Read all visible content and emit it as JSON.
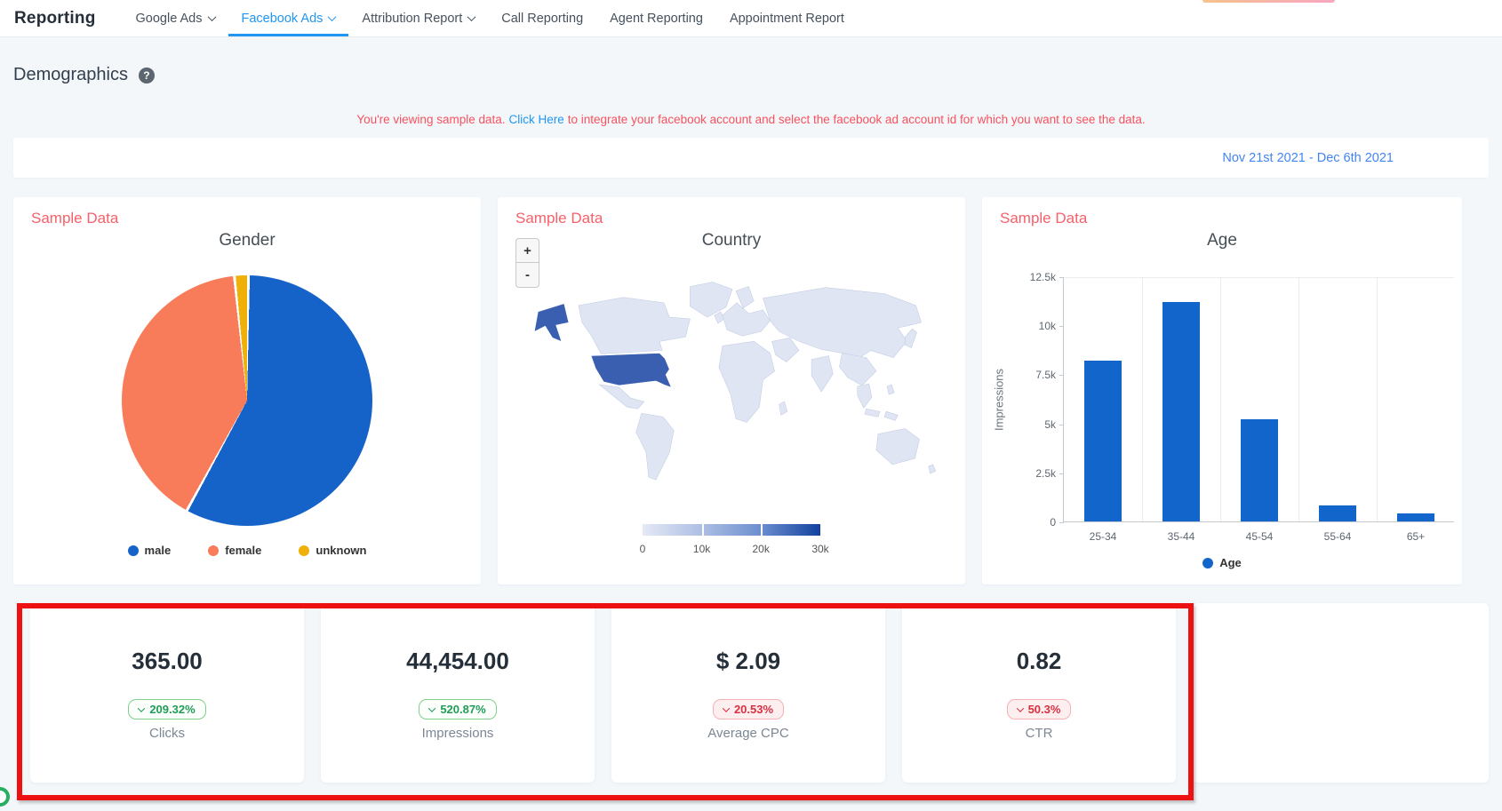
{
  "header": {
    "brand": "Reporting",
    "tabs": [
      {
        "label": "Google Ads",
        "caret": true,
        "active": false
      },
      {
        "label": "Facebook Ads",
        "caret": true,
        "active": true
      },
      {
        "label": "Attribution Report",
        "caret": true,
        "active": false
      },
      {
        "label": "Call Reporting",
        "caret": false,
        "active": false
      },
      {
        "label": "Agent Reporting",
        "caret": false,
        "active": false
      },
      {
        "label": "Appointment Report",
        "caret": false,
        "active": false
      }
    ]
  },
  "page": {
    "title": "Demographics",
    "help_glyph": "?",
    "notice": {
      "prefix": "You're viewing sample data.",
      "link": "Click Here",
      "suffix": "to integrate your facebook account and select the facebook ad account id for which you want to see the data."
    },
    "date_range": "Nov 21st 2021 - Dec 6th 2021",
    "sample_data_label": "Sample Data"
  },
  "map_controls": {
    "zoom_in": "+",
    "zoom_out": "-"
  },
  "chart_data": [
    {
      "type": "pie",
      "title": "Gender",
      "labels": [
        "male",
        "female",
        "unknown"
      ],
      "values_pct": [
        57.8,
        40.4,
        1.8
      ],
      "colors": [
        "#1563c9",
        "#f97c5a",
        "#eeb009"
      ],
      "legend_position": "bottom"
    },
    {
      "type": "heatmap",
      "title": "Country",
      "note": "world choropleth, United States highlighted",
      "highlighted_region": "United States",
      "scale": {
        "min": 0,
        "max": 30000,
        "ticks": [
          "0",
          "10k",
          "20k",
          "30k"
        ]
      }
    },
    {
      "type": "bar",
      "title": "Age",
      "categories": [
        "25-34",
        "35-44",
        "45-54",
        "55-64",
        "65+"
      ],
      "values": [
        8200,
        11200,
        5200,
        800,
        400
      ],
      "ylabel": "Impressions",
      "yticks": [
        "0",
        "2.5k",
        "5k",
        "7.5k",
        "10k",
        "12.5k"
      ],
      "ylim": [
        0,
        12500
      ],
      "legend": "Age",
      "grid": "vertical",
      "legend_position": "bottom"
    }
  ],
  "metrics": {
    "items": [
      {
        "value": "365.00",
        "change": "209.32%",
        "label": "Clicks",
        "color": "green"
      },
      {
        "value": "44,454.00",
        "change": "520.87%",
        "label": "Impressions",
        "color": "green"
      },
      {
        "value": "$ 2.09",
        "change": "20.53%",
        "label": "Average CPC",
        "color": "red"
      },
      {
        "value": "0.82",
        "change": "50.3%",
        "label": "CTR",
        "color": "red"
      }
    ]
  },
  "colors": {
    "accent_blue": "#2196f3",
    "notice_red": "#f7525e",
    "sample_red": "#f7606a",
    "date_blue": "#4285f4",
    "bar_blue": "#1266cb",
    "map_country": "#dfe5f3",
    "map_highlight": "#3a5fb0",
    "badge_green_text": "#1f9d55",
    "badge_green_border": "#7fd08a",
    "badge_red_text": "#d9303e",
    "badge_red_border": "#f3b1b6",
    "annotation_red": "#ee1111"
  }
}
